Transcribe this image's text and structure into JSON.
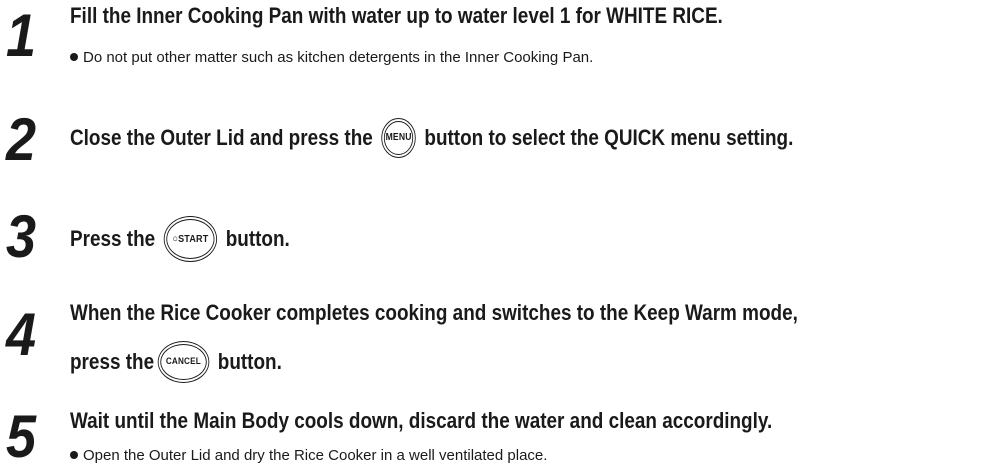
{
  "steps": [
    {
      "number": "1",
      "text": "Fill the Inner Cooking Pan with water up to water level 1 for WHITE RICE.",
      "note": "Do not put other matter such as kitchen detergents in the Inner Cooking Pan."
    },
    {
      "number": "2",
      "text_before": "Close the Outer Lid and press the",
      "button": "MENU",
      "text_after": "button to select the QUICK menu setting."
    },
    {
      "number": "3",
      "text_before": "Press the",
      "button": "○START",
      "text_after": "button."
    },
    {
      "number": "4",
      "text_line1": "When the Rice Cooker completes cooking and switches to the Keep Warm mode,",
      "text_before": "press the",
      "button": "CANCEL",
      "text_after": "button."
    },
    {
      "number": "5",
      "text": "Wait until the Main Body cools down, discard the water and clean accordingly.",
      "note": "Open the Outer Lid and dry the Rice Cooker in a well ventilated place."
    }
  ]
}
